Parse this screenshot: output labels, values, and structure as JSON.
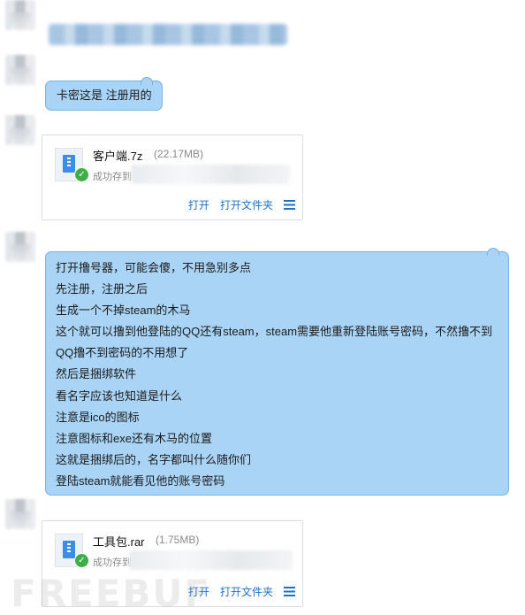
{
  "messages": {
    "msg2": {
      "text": "卡密这是 注册用的"
    },
    "file1": {
      "name": "客户端.7z",
      "size": "(22.17MB)",
      "status": "成功存到",
      "open": "打开",
      "open_folder": "打开文件夹"
    },
    "long_msg": {
      "lines": [
        "打开撸号器，可能会傻，不用急别多点",
        "先注册，注册之后",
        "生成一个不掉steam的木马",
        "这个就可以撸到他登陆的QQ还有steam，steam需要他重新登陆账号密码，不然撸不到",
        "QQ撸不到密码的不用想了",
        "然后是捆绑软件",
        "看名字应该也知道是什么",
        "注意是ico的图标",
        "注意图标和exe还有木马的位置",
        "这就是捆绑后的，名字都叫什么随你们",
        "登陆steam就能看见他的账号密码"
      ]
    },
    "file2": {
      "name": "工具包.rar",
      "size": "(1.75MB)",
      "status": "成功存到",
      "open": "打开",
      "open_folder": "打开文件夹"
    }
  },
  "watermark": "FREEBUF",
  "colors": {
    "bubble": "#a9d4f5",
    "bubble_border": "#79b3e1",
    "link": "#1e72c8",
    "check": "#3fae49"
  },
  "icons": [
    "zip-file-icon",
    "check-circle-icon",
    "menu-icon"
  ]
}
